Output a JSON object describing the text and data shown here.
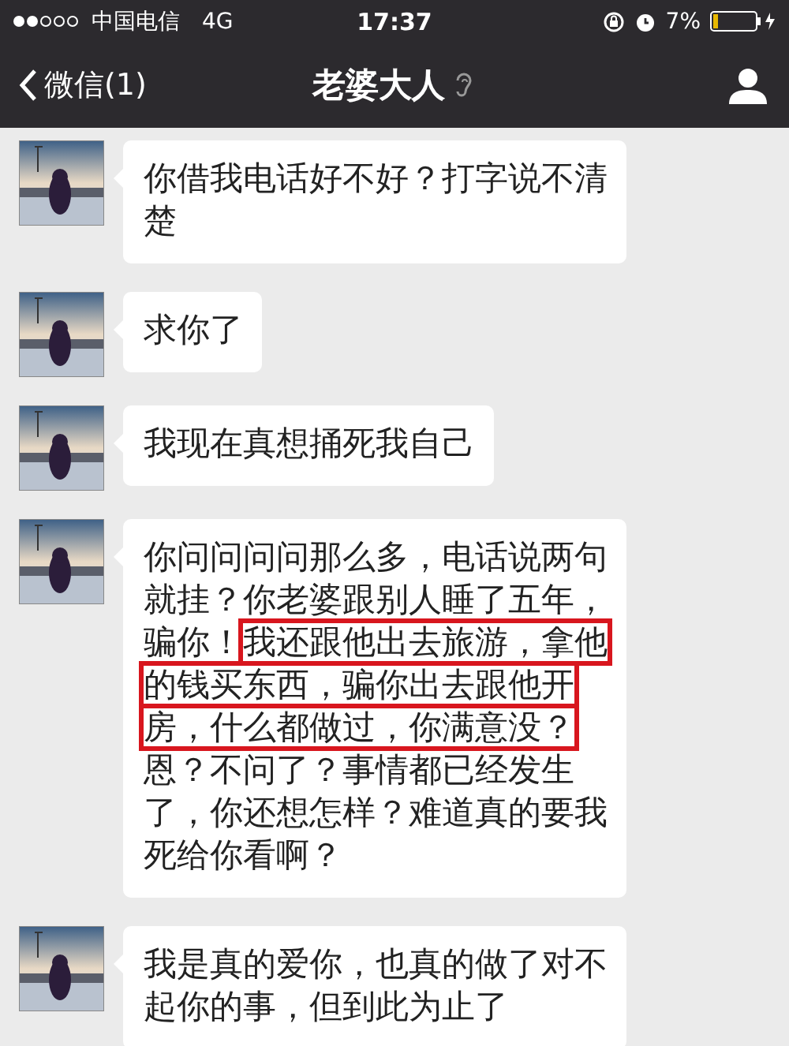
{
  "status_bar": {
    "carrier": "中国电信",
    "network": "4G",
    "time": "17:37",
    "battery": "7%"
  },
  "nav_bar": {
    "back_label": "微信(1)",
    "title": "老婆大人"
  },
  "messages": [
    {
      "lines": [
        [
          {
            "text": "你借我电话好不好？打字说不清",
            "highlighted": false
          }
        ],
        [
          {
            "text": "楚",
            "highlighted": false
          }
        ]
      ]
    },
    {
      "lines": [
        [
          {
            "text": "求你了",
            "highlighted": false
          }
        ]
      ]
    },
    {
      "lines": [
        [
          {
            "text": "我现在真想捅死我自己",
            "highlighted": false
          }
        ]
      ]
    },
    {
      "lines": [
        [
          {
            "text": "你问问问问那么多，电话说两句",
            "highlighted": false
          }
        ],
        [
          {
            "text": "就挂？你老婆跟别人睡了五年，",
            "highlighted": false
          }
        ],
        [
          {
            "text": "骗你！",
            "highlighted": false
          },
          {
            "text": "我还跟他出去旅游，拿他",
            "highlighted": true
          }
        ],
        [
          {
            "text": "的钱买东西，骗你出去跟他开",
            "highlighted": true
          }
        ],
        [
          {
            "text": "房，什么都做过，你满意没？",
            "highlighted": true
          }
        ],
        [
          {
            "text": "恩？不问了？事情都已经发生",
            "highlighted": false
          }
        ],
        [
          {
            "text": "了，你还想怎样？难道真的要我",
            "highlighted": false
          }
        ],
        [
          {
            "text": "死给你看啊？",
            "highlighted": false
          }
        ]
      ]
    },
    {
      "lines": [
        [
          {
            "text": "我是真的爱你，也真的做了对不",
            "highlighted": false
          }
        ],
        [
          {
            "text": "起你的事，但到此为止了",
            "highlighted": false
          }
        ]
      ]
    }
  ]
}
